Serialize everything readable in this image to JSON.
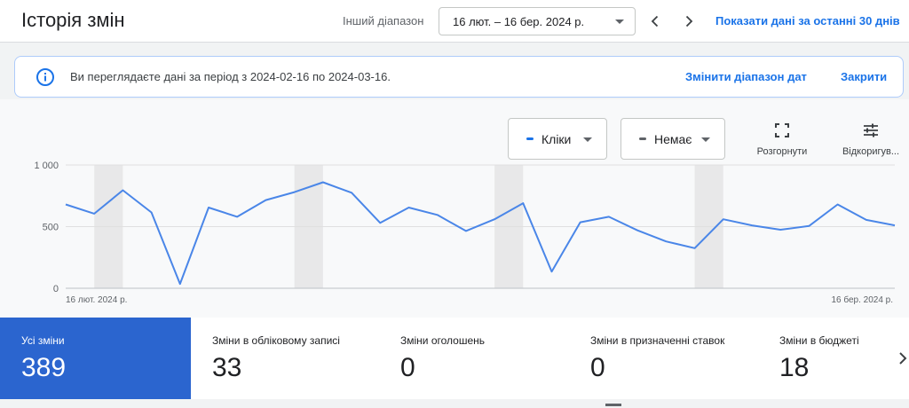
{
  "header": {
    "title": "Історія змін",
    "range_label": "Інший діапазон",
    "date_range": "16 лют. – 16 бер. 2024 р.",
    "last30_link": "Показати дані за останні 30 днів"
  },
  "banner": {
    "text": "Ви переглядаєте дані за період з 2024-02-16 по 2024-03-16.",
    "change_link": "Змінити діапазон дат",
    "close_link": "Закрити"
  },
  "controls": {
    "metric1": {
      "label": "Кліки",
      "color": "#1a73e8"
    },
    "metric2": {
      "label": "Немає",
      "color": "#5f6368"
    },
    "expand_label": "Розгорнути",
    "adjust_label": "Відкоригув..."
  },
  "chart_data": {
    "type": "line",
    "x_start_label": "16 лют. 2024 р.",
    "x_end_label": "16 бер. 2024 р.",
    "y_ticks": [
      "1 000",
      "500",
      "0"
    ],
    "ylim": [
      0,
      1000
    ],
    "series": [
      {
        "color": "#4a86e8",
        "values": [
          680,
          605,
          795,
          615,
          35,
          655,
          580,
          715,
          780,
          860,
          775,
          530,
          655,
          595,
          465,
          560,
          690,
          135,
          535,
          580,
          470,
          380,
          325,
          560,
          510,
          475,
          505,
          680,
          555,
          510
        ]
      }
    ],
    "weekend_bands": [
      [
        1,
        2
      ],
      [
        8,
        9
      ],
      [
        15,
        16
      ],
      [
        22,
        23
      ]
    ]
  },
  "tiles": [
    {
      "label": "Усі зміни",
      "value": "389",
      "active": true
    },
    {
      "label": "Зміни в обліковому записі",
      "value": "33",
      "active": false
    },
    {
      "label": "Зміни оголошень",
      "value": "0",
      "active": false
    },
    {
      "label": "Зміни в призначенні ставок",
      "value": "0",
      "active": false
    },
    {
      "label": "Зміни в бюджеті",
      "value": "18",
      "active": false
    }
  ]
}
